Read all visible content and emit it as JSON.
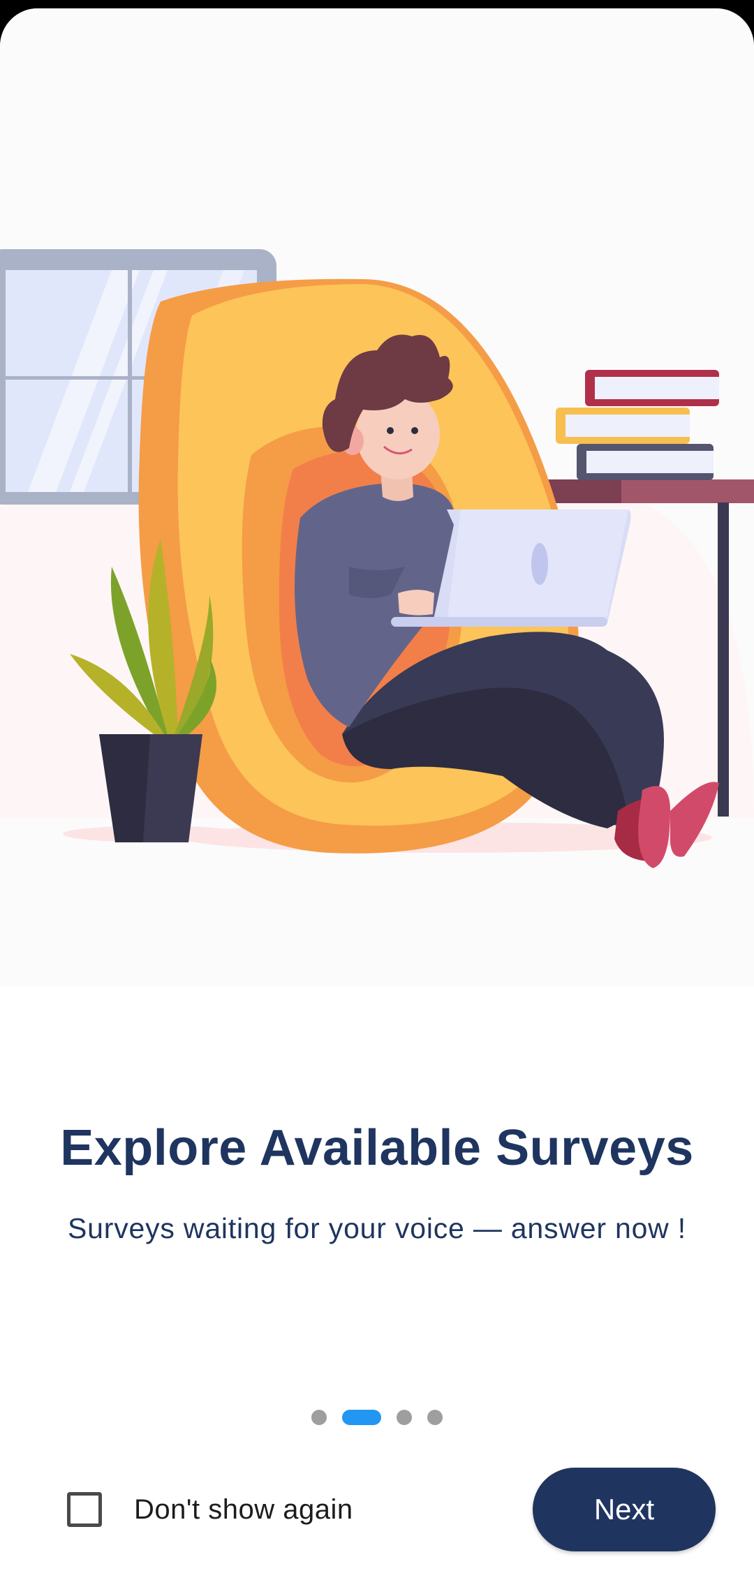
{
  "onboarding": {
    "illustration_icon": "person-on-beanbag-with-laptop-illustration",
    "title": "Explore Available Surveys",
    "subtitle": "Surveys waiting for your voice — answer now !",
    "page_indicator": {
      "total": 4,
      "current": 2
    },
    "dont_show_again_label": "Don't show again",
    "dont_show_again_checked": false,
    "next_label": "Next"
  },
  "colors": {
    "primary": "#1f3560",
    "indicator_active": "#2196f3",
    "indicator_inactive": "#9e9e9e"
  }
}
